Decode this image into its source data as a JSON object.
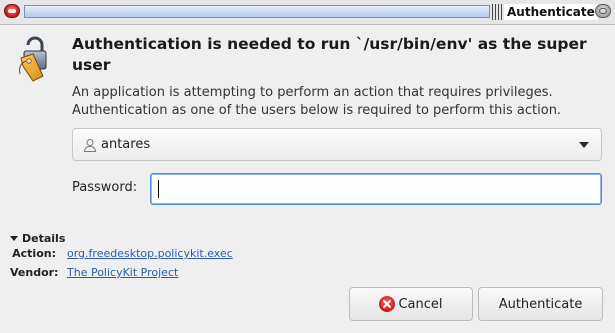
{
  "window": {
    "title": "Authenticate"
  },
  "header": {
    "heading": "Authentication is needed to run `/usr/bin/env' as the super user",
    "description": "An application is attempting to perform an action that requires privileges. Authentication as one of the users below is required to perform this action."
  },
  "identity": {
    "selected_user": "antares"
  },
  "password": {
    "label": "Password:",
    "value": ""
  },
  "details": {
    "toggle_label": "Details",
    "action_label": "Action:",
    "action_value": "org.freedesktop.policykit.exec",
    "vendor_label": "Vendor:",
    "vendor_value": "The PolicyKit Project"
  },
  "buttons": {
    "cancel": "Cancel",
    "authenticate": "Authenticate"
  },
  "icons": {
    "app": "keys-lock-icon",
    "user": "user-icon",
    "dropdown": "chevron-down-icon",
    "cancel": "cancel-icon"
  },
  "colors": {
    "focus_border": "#4a90d9",
    "link": "#2a5db0",
    "cancel_red": "#c9161a"
  }
}
